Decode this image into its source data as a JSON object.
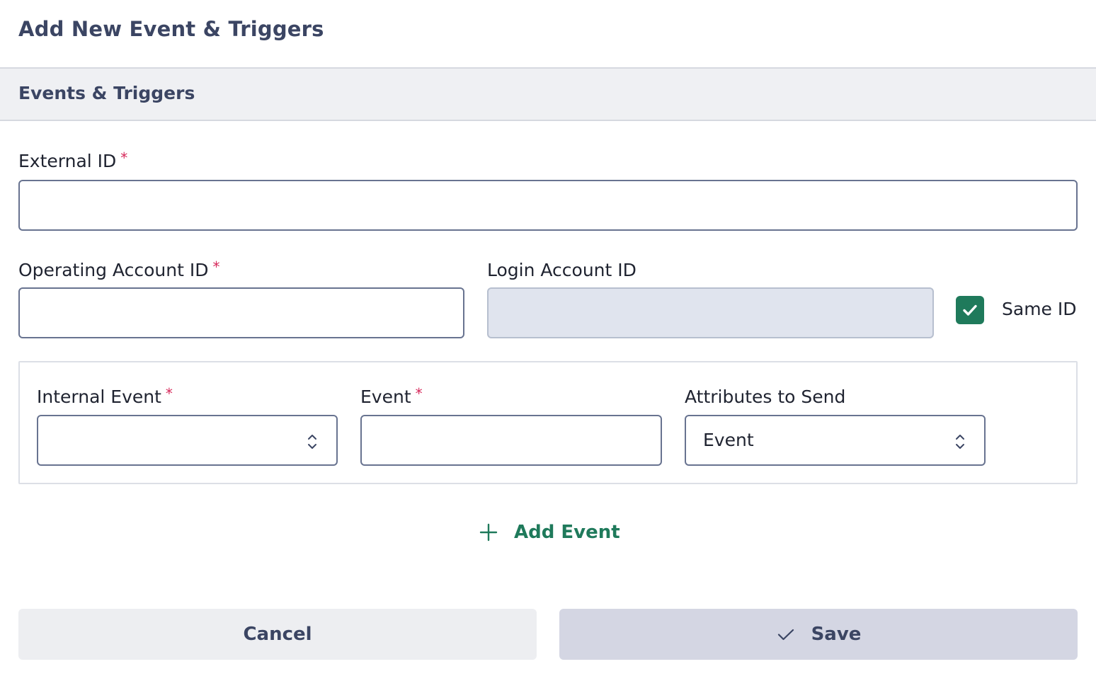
{
  "modal": {
    "title": "Add New Event & Triggers"
  },
  "section": {
    "title": "Events & Triggers"
  },
  "fields": {
    "external_id": {
      "label": "External ID",
      "required_mark": "*",
      "value": "",
      "placeholder": ""
    },
    "operating_account_id": {
      "label": "Operating Account ID",
      "required_mark": "*",
      "value": "",
      "placeholder": ""
    },
    "login_account_id": {
      "label": "Login Account ID",
      "value": "",
      "disabled": true
    },
    "same_id": {
      "label": "Same ID",
      "checked": true,
      "icon": "check-icon",
      "color": "#1f7a5b"
    }
  },
  "event_row": {
    "internal_event": {
      "label": "Internal Event",
      "required_mark": "*",
      "selected": ""
    },
    "event": {
      "label": "Event",
      "required_mark": "*",
      "value": ""
    },
    "attributes_to_send": {
      "label": "Attributes to Send",
      "selected": "Event"
    }
  },
  "add_event": {
    "label": "Add Event",
    "icon": "plus-icon"
  },
  "actions": {
    "cancel_label": "Cancel",
    "save_label": "Save",
    "save_icon": "check-icon"
  },
  "colors": {
    "accent": "#1f7a5b",
    "required": "#d6285a",
    "heading": "#3b4563"
  }
}
